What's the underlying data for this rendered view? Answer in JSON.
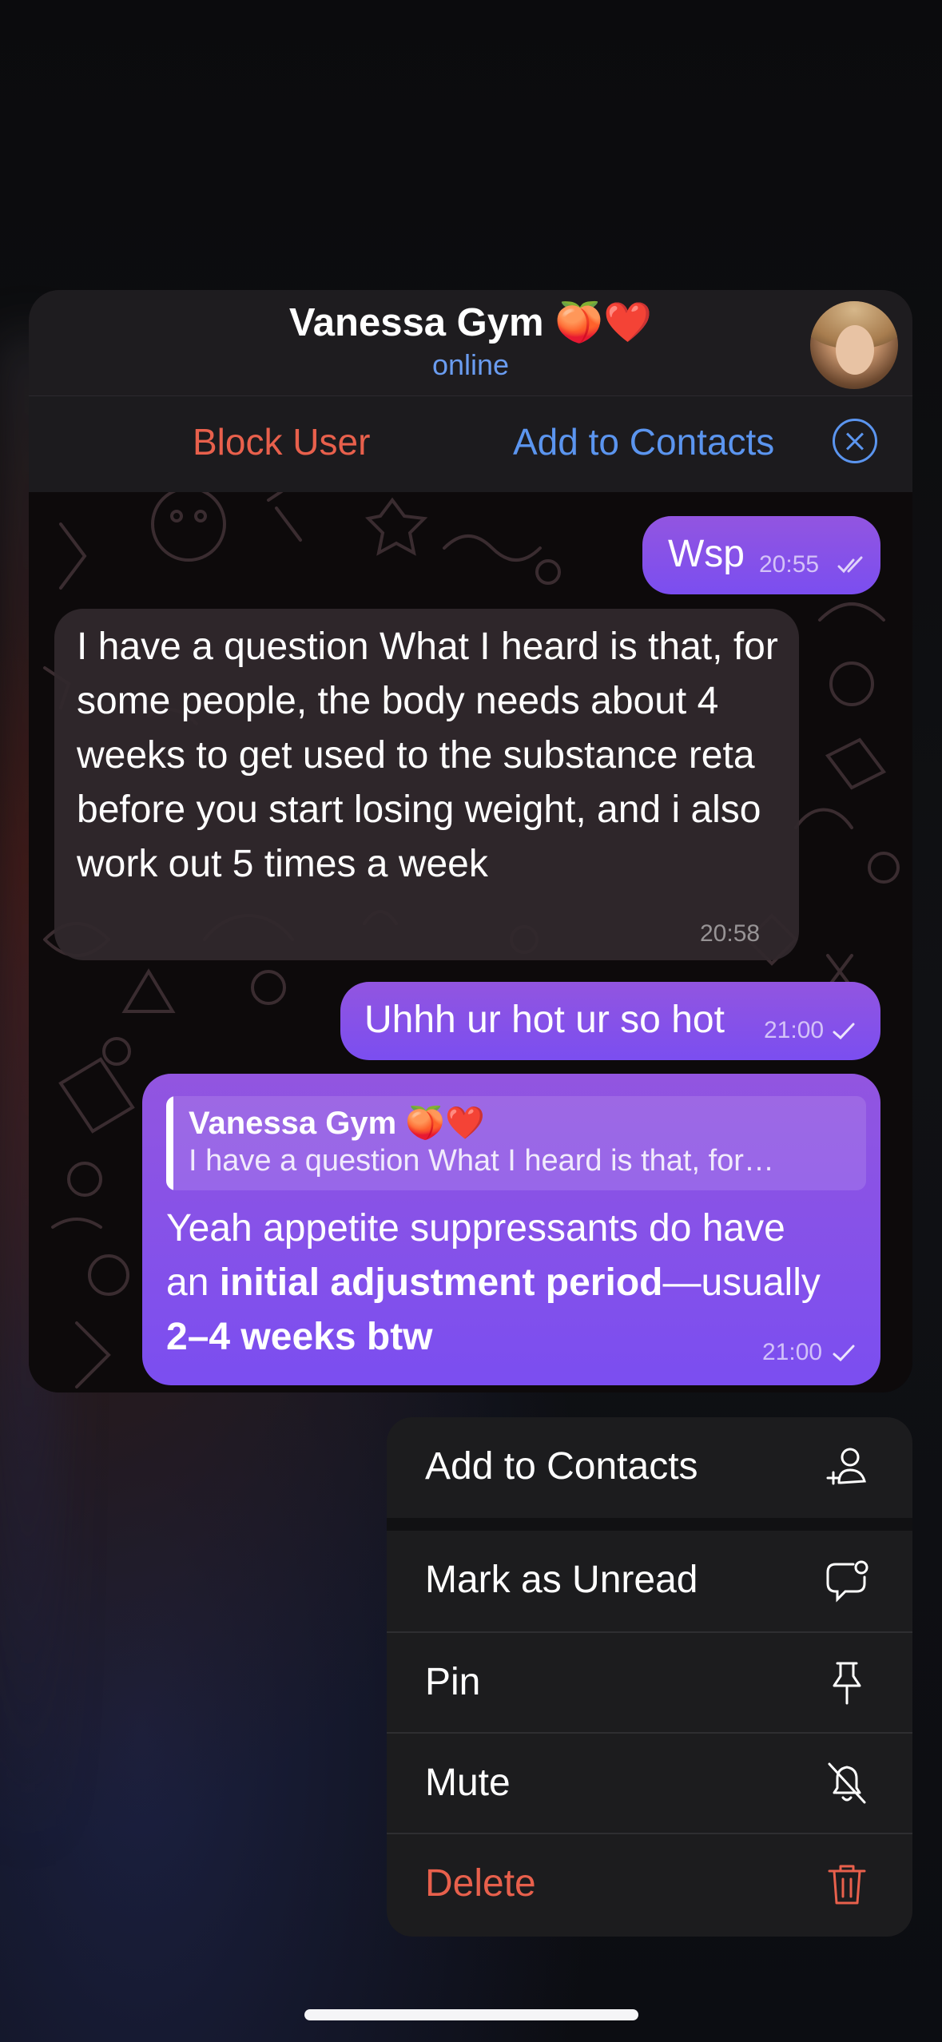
{
  "chat": {
    "title": "Vanessa Gym 🍑❤️",
    "status": "online",
    "block_user": "Block User",
    "add_to_contacts": "Add to Contacts"
  },
  "messages": [
    {
      "direction": "out",
      "text": "Wsp",
      "time": "20:55",
      "status": "read"
    },
    {
      "direction": "in",
      "text": "I have a question What I heard is that, for some people, the body needs about 4 weeks to get used to the substance reta before you start losing weight, and i also work out 5 times a week",
      "time": "20:58"
    },
    {
      "direction": "out",
      "text": "Uhhh ur hot ur so hot",
      "time": "21:00",
      "status": "sent"
    },
    {
      "direction": "out",
      "reply_to_name": "Vanessa Gym 🍑❤️",
      "reply_to_text": "I have a question What I heard is that, for…",
      "text_line1": "Yeah appetite suppressants do have",
      "text_line2_pre": "an ",
      "text_line2_bold": "initial adjustment period",
      "text_line2_post": "—usually",
      "text_line3_bold": "2–4 weeks btw",
      "time": "21:00",
      "status": "sent"
    }
  ],
  "menu": {
    "items": [
      {
        "label": "Add to Contacts",
        "icon": "add-contact-icon"
      },
      {
        "label": "Mark as Unread",
        "icon": "mark-unread-icon"
      },
      {
        "label": "Pin",
        "icon": "pin-icon"
      },
      {
        "label": "Mute",
        "icon": "mute-bell-icon"
      },
      {
        "label": "Delete",
        "icon": "trash-icon",
        "destructive": true
      }
    ]
  },
  "colors": {
    "accent_blue": "#5b95ef",
    "destructive_red": "#e8604c",
    "outgoing_bubble": "#8a52e8",
    "incoming_bubble": "#30282c"
  }
}
